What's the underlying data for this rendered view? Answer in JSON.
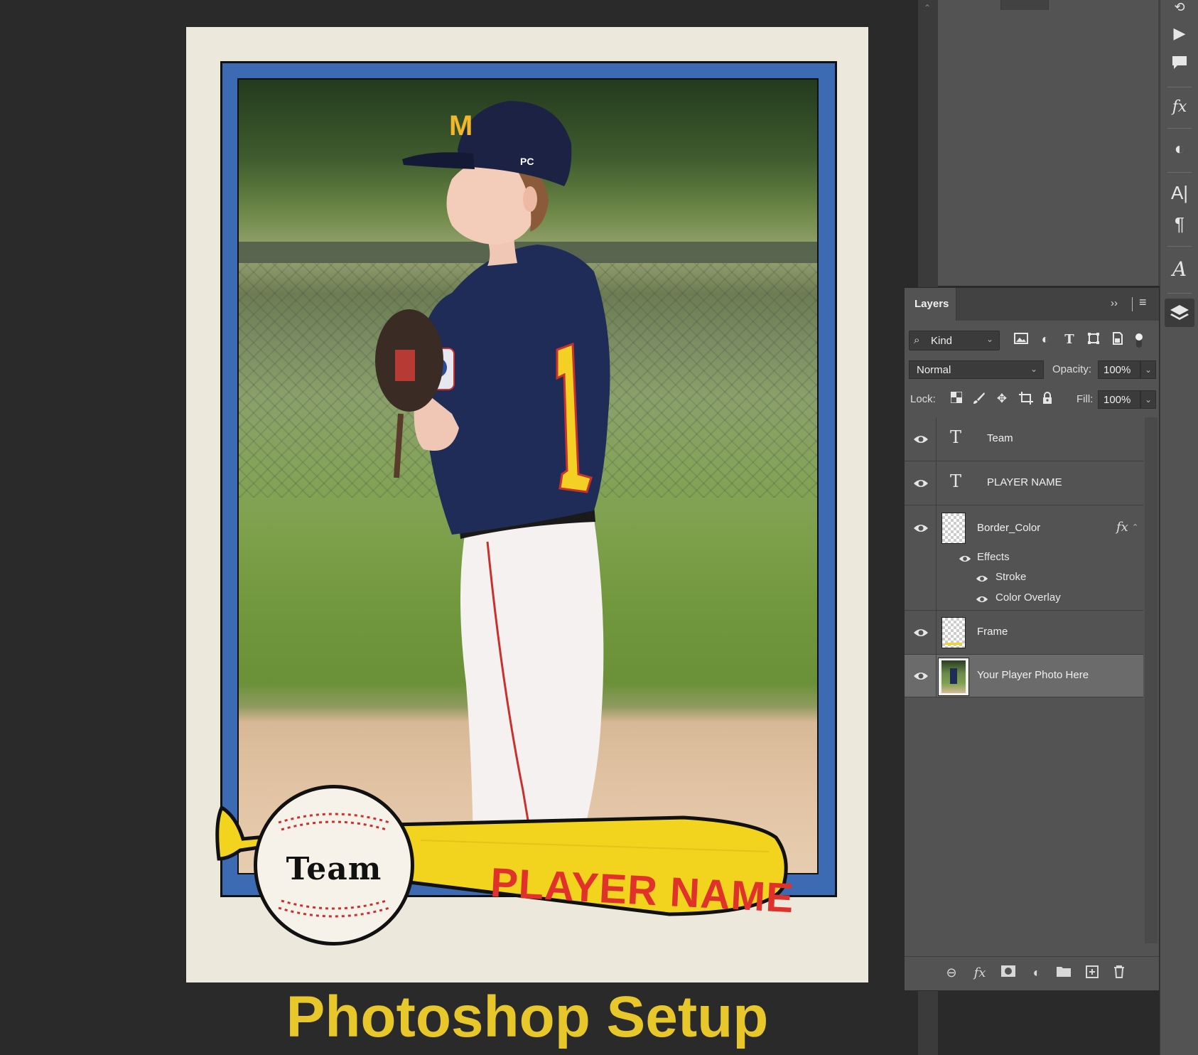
{
  "card": {
    "team_label": "Team",
    "player_name": "PLAYER NAME",
    "caption": "Photoshop Setup",
    "colors": {
      "border": "#3d6bb3",
      "bat": "#f2d41f",
      "name": "#e0312b",
      "caption": "#e8c72a",
      "paper": "#ece8dc"
    }
  },
  "layers_panel": {
    "tab_label": "Layers",
    "collapse_icon": "double-chevron-right-icon",
    "menu_icon": "hamburger-menu-icon",
    "filter": {
      "kind_label": "Kind",
      "icons": [
        "image-filter-icon",
        "adjustment-filter-icon",
        "type-filter-icon",
        "shape-filter-icon",
        "smart-object-filter-icon",
        "filter-toggle-icon"
      ]
    },
    "blend_mode": "Normal",
    "opacity_label": "Opacity:",
    "opacity_value": "100%",
    "lock_label": "Lock:",
    "lock_icons": [
      "lock-transparent-icon",
      "lock-image-icon",
      "lock-position-icon",
      "lock-artboard-icon",
      "lock-all-icon"
    ],
    "fill_label": "Fill:",
    "fill_value": "100%",
    "layers": [
      {
        "name": "Team",
        "type": "text"
      },
      {
        "name": "PLAYER NAME",
        "type": "text"
      },
      {
        "name": "Border_Color",
        "type": "raster",
        "fx": "fx",
        "effects_label": "Effects",
        "effects": [
          "Stroke",
          "Color Overlay"
        ]
      },
      {
        "name": "Frame",
        "type": "raster"
      },
      {
        "name": "Your Player Photo Here",
        "type": "photo",
        "selected": true
      }
    ],
    "footer_icons": [
      "link-layers-icon",
      "add-style-icon",
      "add-mask-icon",
      "new-adjustment-icon",
      "new-group-icon",
      "new-layer-icon",
      "delete-layer-icon"
    ]
  },
  "right_toolbar": {
    "icons": [
      "history-icon",
      "play-icon",
      "comment-icon",
      "styles-fx-icon",
      "adjustments-icon",
      "character-icon",
      "paragraph-icon",
      "glyphs-icon",
      "layers-icon"
    ]
  }
}
